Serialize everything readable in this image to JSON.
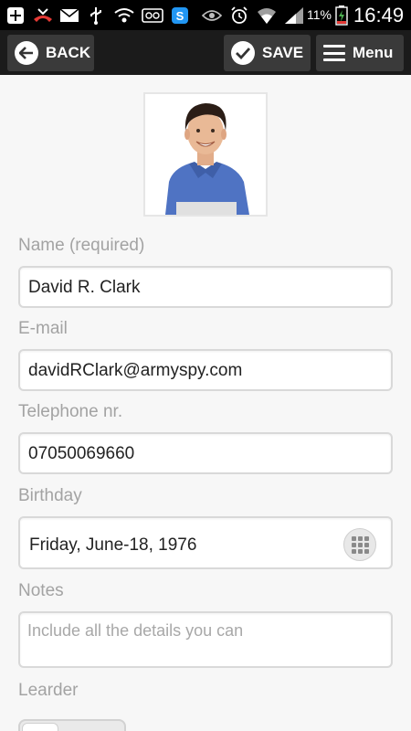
{
  "status_bar": {
    "battery_percent": "11%",
    "time": "16:49",
    "icons": [
      "add-icon",
      "missed-call-icon",
      "mail-icon",
      "usb-icon",
      "wifi-icon",
      "voicemail-icon",
      "skype-icon",
      "eye-icon",
      "alarm-icon",
      "wifi-signal-icon",
      "cell-signal-icon",
      "battery-icon"
    ]
  },
  "action_bar": {
    "back_label": "BACK",
    "save_label": "SAVE",
    "menu_label": "Menu"
  },
  "form": {
    "name_label": "Name (required)",
    "name_value": "David R. Clark",
    "email_label": "E-mail",
    "email_value": "davidRClark@armyspy.com",
    "phone_label": "Telephone nr.",
    "phone_value": "07050069660",
    "birthday_label": "Birthday",
    "birthday_value": "Friday, June-18, 1976",
    "notes_label": "Notes",
    "notes_placeholder": "Include all the details you can",
    "leader_label": "Learder",
    "leader_toggle_on": false
  },
  "colors": {
    "action_bar_bg": "#1b1b1b",
    "button_bg": "#3a3a3a",
    "label_gray": "#a3a3a3",
    "shirt_blue": "#4f73c3"
  }
}
